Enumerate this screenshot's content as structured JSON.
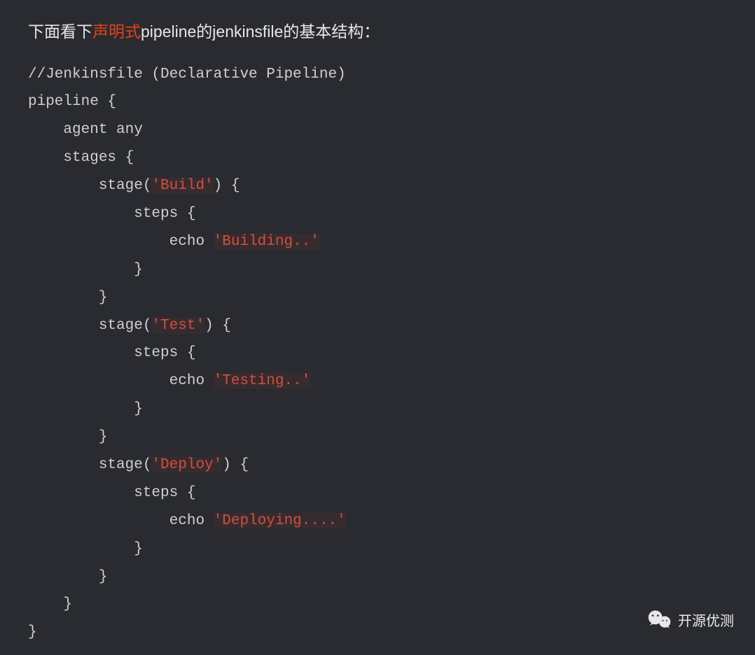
{
  "heading": {
    "before": "下面看下",
    "highlight": "声明式",
    "after": "pipeline的jenkinsfile的基本结构："
  },
  "code": {
    "line1": "//Jenkinsfile (Declarative Pipeline)",
    "line2": "pipeline {",
    "line3": "    agent any",
    "line4": "    stages {",
    "line5a": "        stage(",
    "line5b": "'Build'",
    "line5c": ") {",
    "line6": "            steps {",
    "line7a": "                echo ",
    "line7b": "'Building..'",
    "line8": "            }",
    "line9": "        }",
    "line10a": "        stage(",
    "line10b": "'Test'",
    "line10c": ") {",
    "line11": "            steps {",
    "line12a": "                echo ",
    "line12b": "'Testing..'",
    "line13": "            }",
    "line14": "        }",
    "line15a": "        stage(",
    "line15b": "'Deploy'",
    "line15c": ") {",
    "line16": "            steps {",
    "line17a": "                echo ",
    "line17b": "'Deploying....'",
    "line18": "            }",
    "line19": "        }",
    "line20": "    }",
    "line21": "}"
  },
  "watermark": {
    "text": "开源优测"
  }
}
